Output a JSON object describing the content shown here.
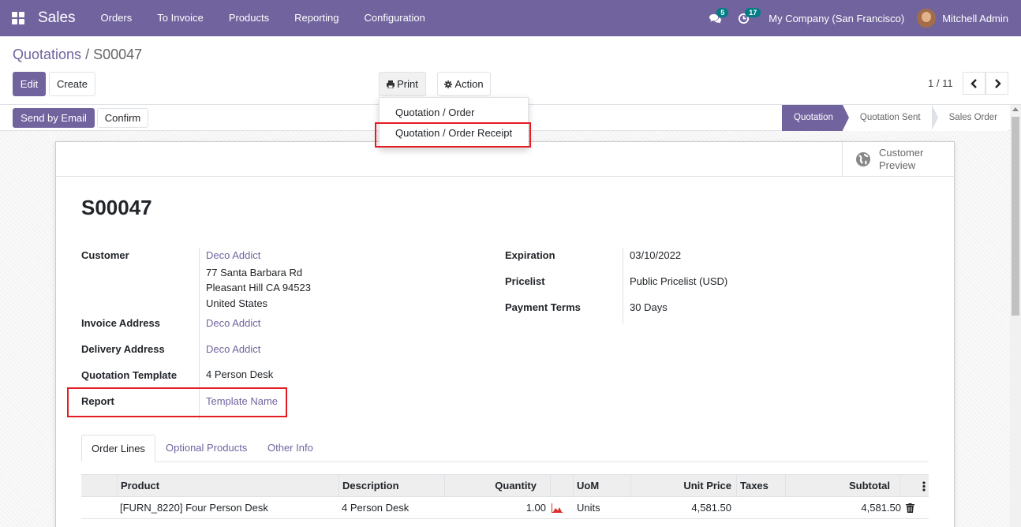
{
  "navbar": {
    "app_title": "Sales",
    "menu": [
      "Orders",
      "To Invoice",
      "Products",
      "Reporting",
      "Configuration"
    ],
    "messages_count": "5",
    "activities_count": "17",
    "company": "My Company (San Francisco)",
    "user": "Mitchell Admin"
  },
  "breadcrumb": {
    "parent": "Quotations",
    "separator": "/",
    "current": "S00047"
  },
  "buttons": {
    "edit": "Edit",
    "create": "Create",
    "print": "Print",
    "action": "Action",
    "send_by_email": "Send by Email",
    "confirm": "Confirm"
  },
  "pager": {
    "value": "1 / 11"
  },
  "print_menu": {
    "items": [
      "Quotation / Order",
      "Quotation / Order Receipt"
    ]
  },
  "status": {
    "steps": [
      "Quotation",
      "Quotation Sent",
      "Sales Order"
    ],
    "active": "Quotation"
  },
  "smart_button": {
    "line1": "Customer",
    "line2": "Preview"
  },
  "record": {
    "name": "S00047",
    "labels": {
      "customer": "Customer",
      "invoice_address": "Invoice Address",
      "delivery_address": "Delivery Address",
      "quotation_template": "Quotation Template",
      "report": "Report",
      "expiration": "Expiration",
      "pricelist": "Pricelist",
      "payment_terms": "Payment Terms"
    },
    "customer": "Deco Addict",
    "address_line1": "77 Santa Barbara Rd",
    "address_line2": "Pleasant Hill CA 94523",
    "address_line3": "United States",
    "invoice_address": "Deco Addict",
    "delivery_address": "Deco Addict",
    "quotation_template": "4 Person Desk",
    "report": "Template Name",
    "expiration": "03/10/2022",
    "pricelist": "Public Pricelist (USD)",
    "payment_terms": "30 Days"
  },
  "tabs": [
    "Order Lines",
    "Optional Products",
    "Other Info"
  ],
  "table": {
    "columns": [
      "Product",
      "Description",
      "Quantity",
      "UoM",
      "Unit Price",
      "Taxes",
      "Subtotal"
    ],
    "rows": [
      {
        "product": "[FURN_8220] Four Person Desk",
        "description": "4 Person Desk",
        "quantity": "1.00",
        "uom": "Units",
        "unit_price": "4,581.50",
        "taxes": "",
        "subtotal": "4,581.50"
      }
    ]
  },
  "colors": {
    "brand": "#71639e",
    "highlight": "#e31b23",
    "badge": "#017e84"
  }
}
